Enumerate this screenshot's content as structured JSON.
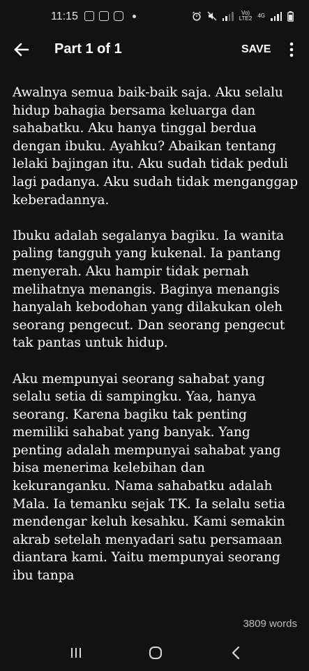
{
  "status_bar": {
    "time": "11:15",
    "network_label_top": "Vo)",
    "network_label_bottom": "LTE2",
    "data_label": "4G"
  },
  "app_bar": {
    "title": "Part 1 of 1",
    "save_label": "SAVE"
  },
  "content": {
    "paragraphs": [
      "Awalnya semua baik-baik saja. Aku selalu hidup bahagia bersama keluarga dan sahabatku. Aku hanya tinggal berdua dengan ibuku. Ayahku? Abaikan tentang lelaki bajingan itu. Aku sudah tidak peduli lagi padanya. Aku sudah tidak menganggap keberadannya.",
      "Ibuku adalah segalanya bagiku. Ia wanita paling tangguh yang kukenal. Ia pantang menyerah. Aku hampir tidak pernah melihatnya menangis. Baginya menangis hanyalah kebodohan yang dilakukan oleh seorang pengecut. Dan seorang pengecut tak pantas untuk hidup.",
      "Aku mempunyai seorang sahabat yang selalu setia di sampingku. Yaa, hanya seorang. Karena bagiku tak penting memiliki sahabat yang banyak. Yang penting adalah mempunyai sahabat yang bisa menerima kelebihan dan kekuranganku. Nama sahabatku adalah Mala. Ia temanku sejak TK. Ia selalu setia mendengar keluh kesahku. Kami semakin akrab setelah menyadari satu persamaan diantara kami. Yaitu mempunyai seorang ibu tanpa"
    ]
  },
  "word_count": "3809 words",
  "colors": {
    "background": "#121212",
    "text": "#ffffff",
    "muted": "#bdbdbd"
  }
}
